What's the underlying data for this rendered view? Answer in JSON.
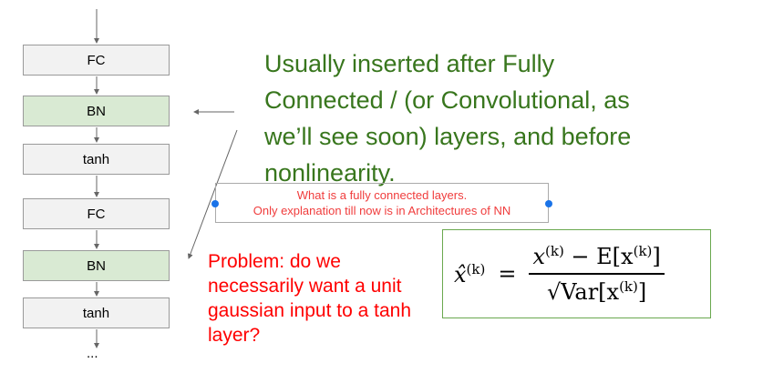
{
  "diagram": {
    "layers": [
      {
        "label": "FC",
        "type": "fc"
      },
      {
        "label": "BN",
        "type": "bn"
      },
      {
        "label": "tanh",
        "type": "act"
      },
      {
        "label": "FC",
        "type": "fc"
      },
      {
        "label": "BN",
        "type": "bn"
      },
      {
        "label": "tanh",
        "type": "act"
      }
    ],
    "continuation": "..."
  },
  "note": {
    "lines": [
      "Usually inserted after Fully",
      "Connected / (or Convolutional, as",
      "we’ll see soon) layers, and before",
      "nonlinearity."
    ]
  },
  "comment": {
    "line1": "What is a fully connected layers.",
    "line2": "Only explanation till now is in Architectures of NN"
  },
  "problem": {
    "text": "Problem: do we necessarily want a unit gaussian input to a tanh layer?"
  },
  "formula": {
    "lhs": "x̂",
    "sup": "(k)",
    "equals": "=",
    "numerator": "x",
    "minus": " − E[x",
    "close": "]",
    "denominator": "√Var[x"
  },
  "colors": {
    "green": "#38761d",
    "red": "#ff0000",
    "bn": "#d9ead3"
  }
}
